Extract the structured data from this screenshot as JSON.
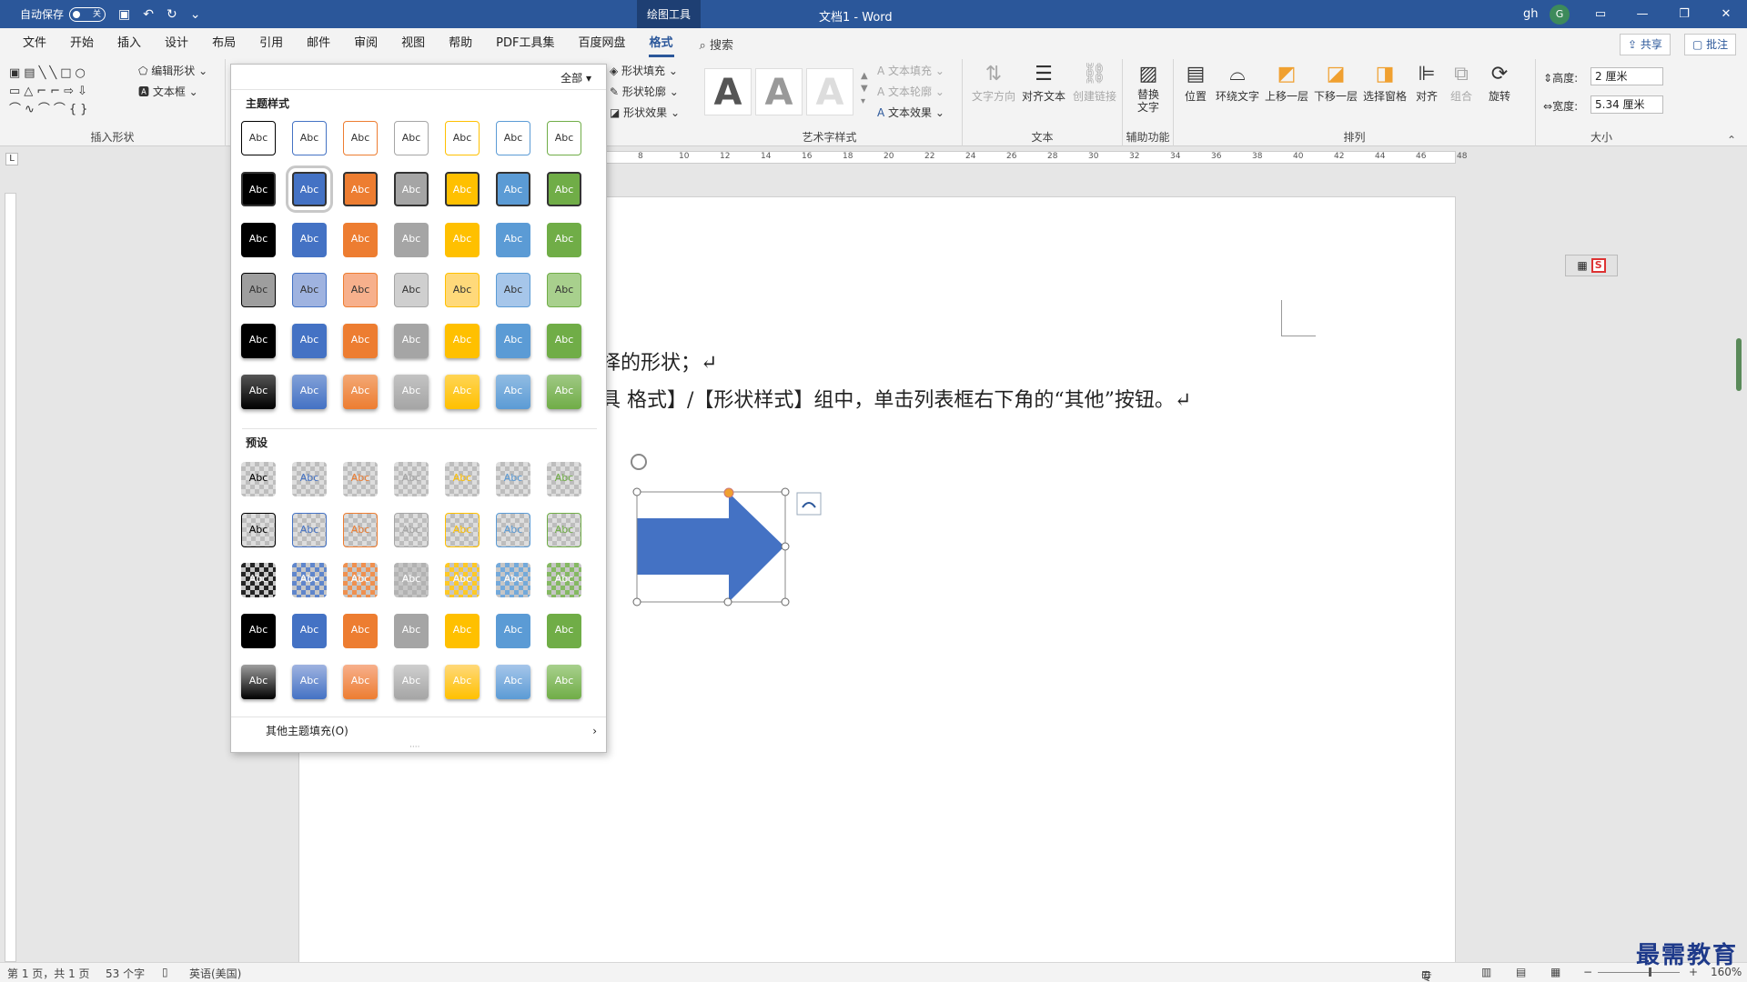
{
  "titlebar": {
    "autosave_label": "自动保存",
    "autosave_state": "关",
    "context_tab": "绘图工具",
    "doc_title": "文档1  -  Word",
    "user": "gh",
    "avatar_initial": "G"
  },
  "tabs": [
    "文件",
    "开始",
    "插入",
    "设计",
    "布局",
    "引用",
    "邮件",
    "审阅",
    "视图",
    "帮助",
    "PDF工具集",
    "百度网盘",
    "格式"
  ],
  "search_label": "搜索",
  "share_label": "共享",
  "comment_label": "批注",
  "ribbon": {
    "insert_shapes": {
      "edit_shape": "编辑形状",
      "textbox": "文本框",
      "label": "插入形状"
    },
    "shape_styles": {
      "fill": "形状填充",
      "outline": "形状轮廓",
      "effects": "形状效果"
    },
    "wordart": {
      "text_fill": "文本填充",
      "text_outline": "文本轮廓",
      "text_effects": "文本效果",
      "label": "艺术字样式",
      "letter": "A"
    },
    "text": {
      "direction": "文字方向",
      "align": "对齐文本",
      "link": "创建链接",
      "label": "文本"
    },
    "accessibility": {
      "alt_text_1": "替换",
      "alt_text_2": "文字",
      "label": "辅助功能"
    },
    "arrange": {
      "position": "位置",
      "wrap": "环绕文字",
      "forward": "上移一层",
      "backward": "下移一层",
      "pane": "选择窗格",
      "align": "对齐",
      "group": "组合",
      "rotate": "旋转",
      "label": "排列"
    },
    "size": {
      "height_label": "高度:",
      "height_value": "2 厘米",
      "width_label": "宽度:",
      "width_value": "5.34 厘米",
      "label": "大小"
    }
  },
  "ruler_ticks": [
    "8",
    "10",
    "12",
    "14",
    "16",
    "18",
    "20",
    "22",
    "24",
    "26",
    "28",
    "30",
    "32",
    "34",
    "36",
    "38",
    "40",
    "42",
    "44",
    "46",
    "48"
  ],
  "document": {
    "line1": "择的形状；↵",
    "line2": "具 格式】/【形状样式】组中，单击列表框右下角的“其他”按钮。↵"
  },
  "gallery": {
    "filter": "全部",
    "theme_title": "主题样式",
    "preset_title": "预设",
    "swatch_text": "Abc",
    "more_label": "其他主题填充(O)"
  },
  "colors": {
    "accent": "#2b579a",
    "shape_fill": "#4472c4",
    "dark": "#000000",
    "blue": "#4472c4",
    "orange": "#ed7d31",
    "gray": "#a5a5a5",
    "gold": "#ffc000",
    "lightblue": "#5b9bd5",
    "green": "#70ad47"
  },
  "statusbar": {
    "page": "第 1 页，共 1 页",
    "words": "53 个字",
    "lang": "英语(美国)",
    "focus": "专注",
    "zoom": "160%"
  },
  "watermark": "最需教育"
}
